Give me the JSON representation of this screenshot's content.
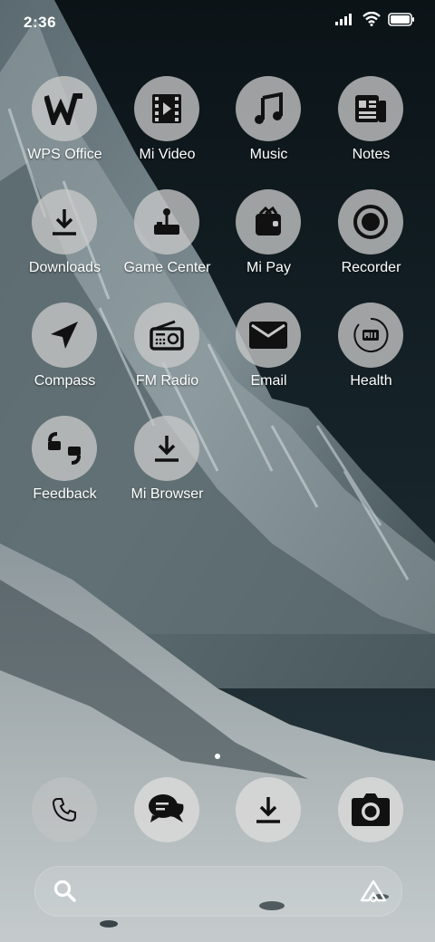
{
  "status_bar": {
    "time": "2:36",
    "icons": [
      "signal-icon",
      "wifi-icon",
      "battery-icon"
    ]
  },
  "apps": [
    {
      "name": "WPS Office",
      "icon": "wps-office-icon"
    },
    {
      "name": "Mi Video",
      "icon": "film-icon"
    },
    {
      "name": "Music",
      "icon": "music-note-icon"
    },
    {
      "name": "Notes",
      "icon": "notes-icon"
    },
    {
      "name": "Downloads",
      "icon": "download-icon"
    },
    {
      "name": "Game Center",
      "icon": "joystick-icon"
    },
    {
      "name": "Mi Pay",
      "icon": "wallet-icon"
    },
    {
      "name": "Recorder",
      "icon": "record-icon"
    },
    {
      "name": "Compass",
      "icon": "compass-arrow-icon"
    },
    {
      "name": "FM Radio",
      "icon": "radio-icon"
    },
    {
      "name": "Email",
      "icon": "envelope-icon"
    },
    {
      "name": "Health",
      "icon": "health-ring-icon"
    },
    {
      "name": "Feedback",
      "icon": "feedback-quote-icon"
    },
    {
      "name": "Mi Browser",
      "icon": "download-icon"
    }
  ],
  "dock": [
    {
      "icon": "phone-icon"
    },
    {
      "icon": "messages-icon"
    },
    {
      "icon": "download-icon"
    },
    {
      "icon": "camera-icon"
    }
  ],
  "search_bar": {
    "icons": [
      "search-icon",
      "assistant-icon"
    ]
  },
  "page_indicator": {
    "pages": 1,
    "active": 1
  },
  "colors": {
    "icon_bg": "#c8c8c8",
    "glyph": "#111111",
    "label": "#ffffff"
  }
}
